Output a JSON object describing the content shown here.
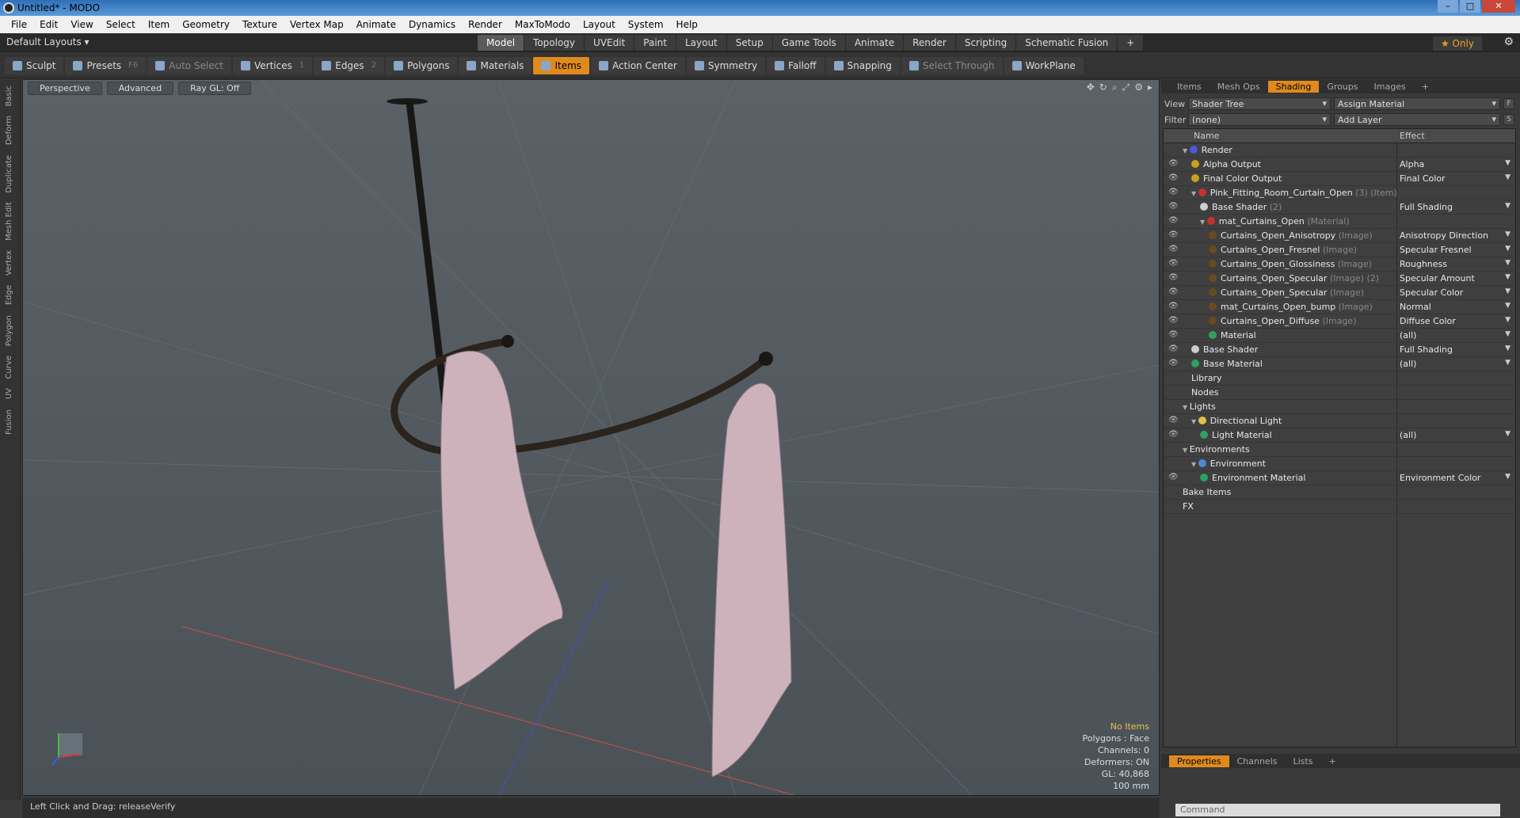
{
  "window": {
    "title": "Untitled* - MODO"
  },
  "menu": [
    "File",
    "Edit",
    "View",
    "Select",
    "Item",
    "Geometry",
    "Texture",
    "Vertex Map",
    "Animate",
    "Dynamics",
    "Render",
    "MaxToModo",
    "Layout",
    "System",
    "Help"
  ],
  "layout_selector": "Default Layouts ▾",
  "mode_tabs": [
    {
      "label": "Model",
      "active": true
    },
    {
      "label": "Topology"
    },
    {
      "label": "UVEdit"
    },
    {
      "label": "Paint"
    },
    {
      "label": "Layout"
    },
    {
      "label": "Setup"
    },
    {
      "label": "Game Tools"
    },
    {
      "label": "Animate"
    },
    {
      "label": "Render"
    },
    {
      "label": "Scripting"
    },
    {
      "label": "Schematic Fusion"
    },
    {
      "label": "+"
    }
  ],
  "only_button": "★  Only",
  "toolbar": [
    {
      "label": "Sculpt"
    },
    {
      "label": "Presets",
      "key": "F6"
    },
    {
      "label": "Auto Select",
      "dim": true
    },
    {
      "label": "Vertices",
      "key": "1"
    },
    {
      "label": "Edges",
      "key": "2"
    },
    {
      "label": "Polygons"
    },
    {
      "label": "Materials"
    },
    {
      "label": "Items",
      "active": true
    },
    {
      "label": "Action Center"
    },
    {
      "label": "Symmetry"
    },
    {
      "label": "Falloff"
    },
    {
      "label": "Snapping"
    },
    {
      "label": "Select Through",
      "dim": true
    },
    {
      "label": "WorkPlane"
    }
  ],
  "left_tabs": [
    "Basic",
    "Deform",
    "Duplicate",
    "Mesh Edit",
    "Vertex",
    "Edge",
    "Polygon",
    "Curve",
    "UV",
    "Fusion"
  ],
  "viewport": {
    "view_mode": "Perspective",
    "shading": "Advanced",
    "raygl": "Ray GL: Off",
    "info": {
      "selection": "No Items",
      "polygons": "Polygons : Face",
      "channels": "Channels: 0",
      "deformers": "Deformers: ON",
      "gl": "GL: 40,868",
      "scale": "100 mm"
    }
  },
  "status": {
    "text": "Left Click and Drag:   releaseVerify"
  },
  "right_tabs": [
    {
      "label": "Items"
    },
    {
      "label": "Mesh Ops"
    },
    {
      "label": "Shading",
      "active": true
    },
    {
      "label": "Groups"
    },
    {
      "label": "Images"
    },
    {
      "label": "+"
    }
  ],
  "shader": {
    "view_label": "View",
    "view_value": "Shader Tree",
    "assign": "Assign Material",
    "filter_label": "Filter",
    "filter_value": "(none)",
    "add_layer": "Add Layer",
    "col_name": "Name",
    "col_effect": "Effect",
    "rows": [
      {
        "indent": 0,
        "name": "Render",
        "effect": "",
        "ball": "#4a5ad8",
        "eye": false,
        "exp": "▼"
      },
      {
        "indent": 1,
        "name": "Alpha Output",
        "effect": "Alpha",
        "ball": "#c8a020",
        "eye": true
      },
      {
        "indent": 1,
        "name": "Final Color Output",
        "effect": "Final Color",
        "ball": "#c8a020",
        "eye": true
      },
      {
        "indent": 1,
        "name": "Pink_Fitting_Room_Curtain_Open",
        "sub": "(3) (Item)",
        "effect": "",
        "ball": "#c83030",
        "eye": true,
        "exp": "▼"
      },
      {
        "indent": 2,
        "name": "Base Shader",
        "sub": "(2)",
        "effect": "Full Shading",
        "ball": "#cccccc",
        "eye": true
      },
      {
        "indent": 2,
        "name": "mat_Curtains_Open",
        "sub": "(Material)",
        "effect": "",
        "ball": "#c83030",
        "eye": true,
        "exp": "▼"
      },
      {
        "indent": 3,
        "name": "Curtains_Open_Anisotropy",
        "sub": "(Image)",
        "effect": "Anisotropy Direction",
        "ball": "#6a4a20",
        "eye": true
      },
      {
        "indent": 3,
        "name": "Curtains_Open_Fresnel",
        "sub": "(Image)",
        "effect": "Specular Fresnel",
        "ball": "#6a4a20",
        "eye": true
      },
      {
        "indent": 3,
        "name": "Curtains_Open_Glossiness",
        "sub": "(Image)",
        "effect": "Roughness",
        "ball": "#6a4a20",
        "eye": true
      },
      {
        "indent": 3,
        "name": "Curtains_Open_Specular",
        "sub": "(Image) (2)",
        "effect": "Specular Amount",
        "ball": "#6a4a20",
        "eye": true
      },
      {
        "indent": 3,
        "name": "Curtains_Open_Specular",
        "sub": "(Image)",
        "effect": "Specular Color",
        "ball": "#6a4a20",
        "eye": true
      },
      {
        "indent": 3,
        "name": "mat_Curtains_Open_bump",
        "sub": "(Image)",
        "effect": "Normal",
        "ball": "#6a4a20",
        "eye": true
      },
      {
        "indent": 3,
        "name": "Curtains_Open_Diffuse",
        "sub": "(Image)",
        "effect": "Diffuse Color",
        "ball": "#6a4a20",
        "eye": true
      },
      {
        "indent": 3,
        "name": "Material",
        "effect": "(all)",
        "ball": "#30a060",
        "eye": true
      },
      {
        "indent": 1,
        "name": "Base Shader",
        "effect": "Full Shading",
        "ball": "#cccccc",
        "eye": true
      },
      {
        "indent": 1,
        "name": "Base Material",
        "effect": "(all)",
        "ball": "#30a060",
        "eye": true
      },
      {
        "indent": 1,
        "name": "Library",
        "effect": "",
        "ball": "",
        "eye": false
      },
      {
        "indent": 1,
        "name": "Nodes",
        "effect": "",
        "ball": "",
        "eye": false
      },
      {
        "indent": 0,
        "name": "Lights",
        "effect": "",
        "ball": "",
        "eye": false,
        "exp": "▼"
      },
      {
        "indent": 1,
        "name": "Directional Light",
        "effect": "",
        "ball": "#e0c040",
        "eye": true,
        "exp": "▼"
      },
      {
        "indent": 2,
        "name": "Light Material",
        "effect": "(all)",
        "ball": "#30a060",
        "eye": true
      },
      {
        "indent": 0,
        "name": "Environments",
        "effect": "",
        "ball": "",
        "eye": false,
        "exp": "▼"
      },
      {
        "indent": 1,
        "name": "Environment",
        "effect": "",
        "ball": "#4a8ad8",
        "eye": false,
        "exp": "▼"
      },
      {
        "indent": 2,
        "name": "Environment Material",
        "effect": "Environment Color",
        "ball": "#30a060",
        "eye": true
      },
      {
        "indent": 0,
        "name": "Bake Items",
        "effect": "",
        "ball": "",
        "eye": false
      },
      {
        "indent": 0,
        "name": "FX",
        "effect": "",
        "ball": "",
        "eye": false
      }
    ]
  },
  "bottom_tabs": [
    {
      "label": "Properties",
      "active": true
    },
    {
      "label": "Channels"
    },
    {
      "label": "Lists"
    },
    {
      "label": "+"
    }
  ],
  "command": {
    "placeholder": "Command"
  }
}
